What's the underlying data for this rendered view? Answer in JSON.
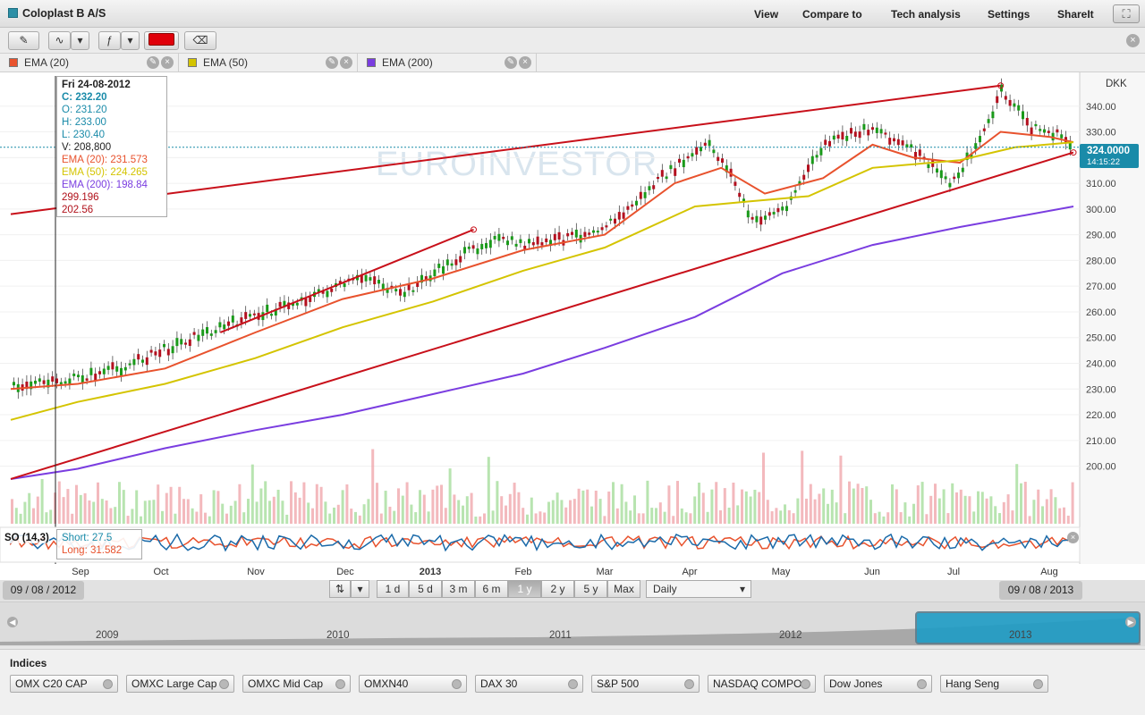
{
  "header": {
    "title": "Coloplast B A/S",
    "menu": [
      "View",
      "Compare to",
      "Tech analysis",
      "Settings",
      "ShareIt"
    ]
  },
  "indicators": [
    {
      "label": "EMA (20)",
      "color": "#e8522d"
    },
    {
      "label": "EMA (50)",
      "color": "#d4c400"
    },
    {
      "label": "EMA (200)",
      "color": "#7a3de0"
    }
  ],
  "watermark": "EUROINVESTOR",
  "currency": "DKK",
  "price_tag": {
    "price": "324.0000",
    "time": "14:15:22"
  },
  "tooltip": {
    "date": "Fri 24-08-2012",
    "close": "C: 232.20",
    "open": "O: 231.20",
    "high": "H: 233.00",
    "low": "L: 230.40",
    "volume": "V: 208,800",
    "ema20": "EMA (20): 231.573",
    "ema50": "EMA (50): 224.265",
    "ema200": "EMA (200): 198.84",
    "line1": "299.196",
    "line2": "202.56"
  },
  "so": {
    "label": "SO (14,3)",
    "short": "Short: 27.5",
    "long": "Long: 31.582"
  },
  "date_range": {
    "start": "09 / 08 / 2012",
    "end": "09 / 08 / 2013"
  },
  "ranges": [
    "1 d",
    "5 d",
    "3 m",
    "6 m",
    "1 y",
    "2 y",
    "5 y",
    "Max"
  ],
  "selected_range": "1 y",
  "interval": "Daily",
  "navigator_years": [
    "2009",
    "2010",
    "2011",
    "2012",
    "2013"
  ],
  "indices_title": "Indices",
  "indices": [
    "OMX C20 CAP",
    "OMXC Large Cap",
    "OMXC Mid Cap",
    "OMXN40",
    "DAX 30",
    "S&P 500",
    "NASDAQ COMPO",
    "Dow Jones",
    "Hang Seng"
  ],
  "chart_data": {
    "type": "line",
    "title": "Coloplast B A/S",
    "ylabel": "DKK",
    "ylim": [
      187,
      350
    ],
    "y_ticks": [
      200,
      210,
      220,
      230,
      240,
      250,
      260,
      270,
      280,
      290,
      300,
      310,
      320,
      330,
      340
    ],
    "x_ticks": [
      "Sep",
      "Oct",
      "Nov",
      "Dec",
      "2013",
      "Feb",
      "Mar",
      "Apr",
      "May",
      "Jun",
      "Jul",
      "Aug"
    ],
    "series": [
      {
        "name": "EMA (20)",
        "color": "#e8522d",
        "points": [
          [
            "2012-08-09",
            230
          ],
          [
            "2012-09-01",
            232
          ],
          [
            "2012-10-01",
            238
          ],
          [
            "2012-11-01",
            252
          ],
          [
            "2012-12-01",
            265
          ],
          [
            "2013-01-01",
            273
          ],
          [
            "2013-02-01",
            284
          ],
          [
            "2013-03-01",
            290
          ],
          [
            "2013-03-25",
            310
          ],
          [
            "2013-04-10",
            316
          ],
          [
            "2013-04-25",
            306
          ],
          [
            "2013-05-15",
            312
          ],
          [
            "2013-06-01",
            325
          ],
          [
            "2013-06-15",
            320
          ],
          [
            "2013-07-01",
            318
          ],
          [
            "2013-07-15",
            330
          ],
          [
            "2013-08-01",
            328
          ],
          [
            "2013-08-09",
            326
          ]
        ]
      },
      {
        "name": "EMA (50)",
        "color": "#d4c400",
        "points": [
          [
            "2012-08-09",
            218
          ],
          [
            "2012-09-01",
            225
          ],
          [
            "2012-10-01",
            232
          ],
          [
            "2012-11-01",
            242
          ],
          [
            "2012-12-01",
            254
          ],
          [
            "2013-01-01",
            264
          ],
          [
            "2013-02-01",
            276
          ],
          [
            "2013-03-01",
            285
          ],
          [
            "2013-04-01",
            301
          ],
          [
            "2013-04-20",
            303
          ],
          [
            "2013-05-10",
            305
          ],
          [
            "2013-06-01",
            316
          ],
          [
            "2013-07-01",
            319
          ],
          [
            "2013-07-20",
            324
          ],
          [
            "2013-08-09",
            326
          ]
        ]
      },
      {
        "name": "EMA (200)",
        "color": "#7a3de0",
        "points": [
          [
            "2012-08-09",
            195
          ],
          [
            "2012-09-01",
            199
          ],
          [
            "2012-10-01",
            207
          ],
          [
            "2012-11-01",
            214
          ],
          [
            "2012-12-01",
            220
          ],
          [
            "2013-01-01",
            228
          ],
          [
            "2013-02-01",
            236
          ],
          [
            "2013-03-01",
            246
          ],
          [
            "2013-04-01",
            258
          ],
          [
            "2013-05-01",
            275
          ],
          [
            "2013-06-01",
            286
          ],
          [
            "2013-07-01",
            293
          ],
          [
            "2013-08-09",
            301
          ]
        ]
      },
      {
        "name": "Price",
        "color": "#1a9a1a",
        "points": [
          [
            "2012-08-09",
            232
          ],
          [
            "2012-08-24",
            232.2
          ],
          [
            "2012-09-15",
            238
          ],
          [
            "2012-10-10",
            250
          ],
          [
            "2012-10-25",
            256
          ],
          [
            "2012-11-10",
            262
          ],
          [
            "2012-11-25",
            268
          ],
          [
            "2012-12-10",
            274
          ],
          [
            "2012-12-20",
            266
          ],
          [
            "2013-01-05",
            278
          ],
          [
            "2013-01-20",
            288
          ],
          [
            "2013-02-05",
            286
          ],
          [
            "2013-02-20",
            290
          ],
          [
            "2013-03-05",
            296
          ],
          [
            "2013-03-20",
            312
          ],
          [
            "2013-04-05",
            325
          ],
          [
            "2013-04-12",
            316
          ],
          [
            "2013-04-20",
            295
          ],
          [
            "2013-05-01",
            300
          ],
          [
            "2013-05-15",
            325
          ],
          [
            "2013-06-01",
            332
          ],
          [
            "2013-06-15",
            322
          ],
          [
            "2013-06-28",
            310
          ],
          [
            "2013-07-10",
            332
          ],
          [
            "2013-07-15",
            346
          ],
          [
            "2013-07-25",
            332
          ],
          [
            "2013-08-05",
            328
          ],
          [
            "2013-08-09",
            324
          ]
        ]
      }
    ],
    "trendlines": [
      {
        "from": [
          "2012-08-09",
          298
        ],
        "to": [
          "2013-07-15",
          348
        ]
      },
      {
        "from": [
          "2012-08-09",
          195
        ],
        "to": [
          "2013-08-09",
          322
        ]
      },
      {
        "from": [
          "2012-10-20",
          252
        ],
        "to": [
          "2013-01-15",
          292
        ]
      }
    ],
    "grid": true
  }
}
